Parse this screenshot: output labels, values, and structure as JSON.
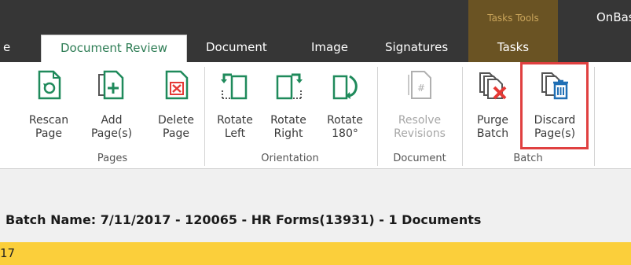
{
  "titlebar": {
    "context_group": "Tasks Tools",
    "app_name": "OnBase"
  },
  "tabs": [
    {
      "label": "e"
    },
    {
      "label": "Document Review",
      "active": true
    },
    {
      "label": "Document"
    },
    {
      "label": "Image"
    },
    {
      "label": "Signatures"
    },
    {
      "label": "Tasks"
    }
  ],
  "ribbon": {
    "groups": [
      {
        "label": "Pages",
        "buttons": [
          {
            "label": "Rescan\nPage",
            "icon": "rescan-page-icon"
          },
          {
            "label": "Add\nPage(s)",
            "icon": "add-pages-icon"
          },
          {
            "label": "Delete\nPage",
            "icon": "delete-page-icon"
          }
        ]
      },
      {
        "label": "Orientation",
        "buttons": [
          {
            "label": "Rotate\nLeft",
            "icon": "rotate-left-icon"
          },
          {
            "label": "Rotate\nRight",
            "icon": "rotate-right-icon"
          },
          {
            "label": "Rotate\n180°",
            "icon": "rotate-180-icon"
          }
        ]
      },
      {
        "label": "Document",
        "buttons": [
          {
            "label": "Resolve\nRevisions",
            "icon": "resolve-revisions-icon",
            "disabled": true
          }
        ]
      },
      {
        "label": "Batch",
        "buttons": [
          {
            "label": "Purge\nBatch",
            "icon": "purge-batch-icon"
          },
          {
            "label": "Discard\nPage(s)",
            "icon": "discard-pages-icon",
            "highlighted": true
          }
        ]
      }
    ]
  },
  "batch_header": "Batch Name: 7/11/2017 - 120065 - HR Forms(13931) - 1 Documents",
  "status_bar": {
    "text": "17"
  },
  "colors": {
    "titlebar_bg": "#363636",
    "context_tab_bg": "#6a5323",
    "active_tab_text": "#2e7d55",
    "icon_accent": "#1f8a5b",
    "delete_red": "#e53935",
    "highlight_border": "#e04040",
    "status_yellow": "#fbcf3b"
  }
}
